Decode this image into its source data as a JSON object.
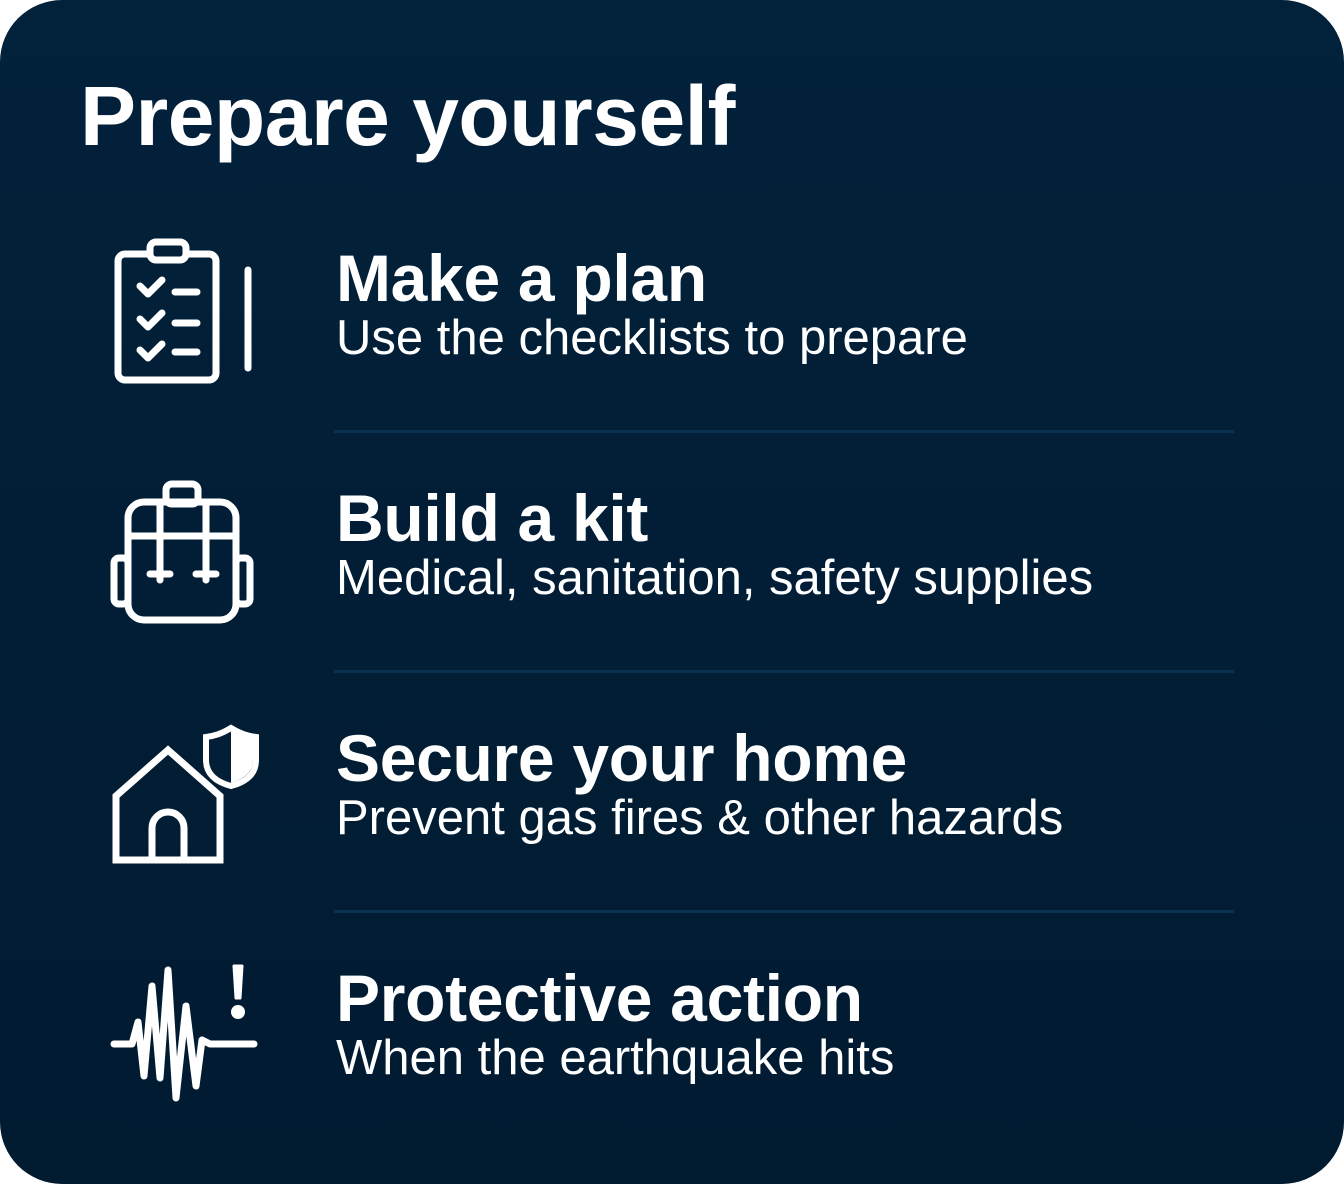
{
  "title": "Prepare yourself",
  "items": [
    {
      "icon": "clipboard-checklist-icon",
      "title": "Make a plan",
      "subtitle": "Use the checklists to prepare"
    },
    {
      "icon": "backpack-icon",
      "title": "Build a kit",
      "subtitle": "Medical, sanitation, safety supplies"
    },
    {
      "icon": "home-shield-icon",
      "title": "Secure your home",
      "subtitle": "Prevent gas fires & other hazards"
    },
    {
      "icon": "seismic-alert-icon",
      "title": "Protective action",
      "subtitle": "When the earthquake hits"
    }
  ],
  "colors": {
    "background": "#011e35",
    "text": "#ffffff",
    "divider": "#0b3150"
  }
}
